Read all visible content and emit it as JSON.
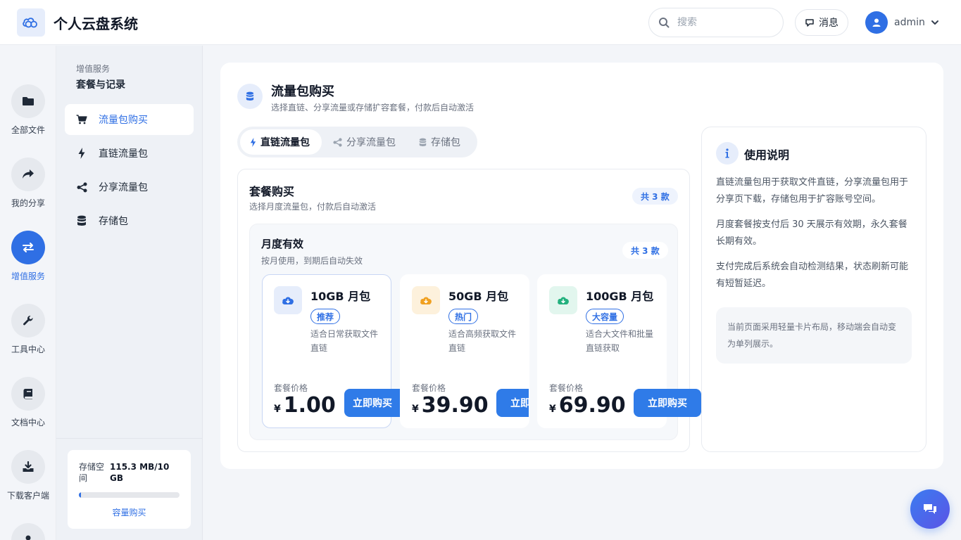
{
  "app": {
    "title": "个人云盘系统"
  },
  "header": {
    "search_placeholder": "搜索",
    "messages_label": "消息",
    "user_name": "admin"
  },
  "rail": {
    "items": [
      {
        "label": "全部文件",
        "icon": "folder-icon"
      },
      {
        "label": "我的分享",
        "icon": "share-arrow-icon"
      },
      {
        "label": "增值服务",
        "icon": "exchange-icon",
        "active": true
      },
      {
        "label": "工具中心",
        "icon": "wrench-icon"
      },
      {
        "label": "文档中心",
        "icon": "book-icon"
      },
      {
        "label": "下载客户端",
        "icon": "download-icon"
      }
    ]
  },
  "sidebar": {
    "category": "增值服务",
    "title": "套餐与记录",
    "items": [
      {
        "label": "流量包购买",
        "icon": "cart-icon",
        "active": true
      },
      {
        "label": "直链流量包",
        "icon": "bolt-icon"
      },
      {
        "label": "分享流量包",
        "icon": "share-nodes-icon"
      },
      {
        "label": "存储包",
        "icon": "database-icon"
      }
    ],
    "storage": {
      "label": "存储空间",
      "value": "115.3 MB/10 GB",
      "used_fraction": 0.011,
      "link": "容量购买"
    }
  },
  "main": {
    "title": "流量包购买",
    "subtitle": "选择直链、分享流量或存储扩容套餐，付款后自动激活",
    "tabs": [
      {
        "label": "直链流量包",
        "icon": "bolt-icon",
        "active": true
      },
      {
        "label": "分享流量包",
        "icon": "share-nodes-icon"
      },
      {
        "label": "存储包",
        "icon": "database-icon"
      }
    ],
    "packages": {
      "title": "套餐购买",
      "subtitle": "选择月度流量包，付款后自动激活",
      "count": "共 3 款",
      "group": {
        "title": "月度有效",
        "subtitle": "按月使用，到期后自动失效",
        "count": "共 3 款",
        "plans": [
          {
            "name": "10GB 月包",
            "tag": "推荐",
            "desc": "适合日常获取文件直链",
            "price_label": "套餐价格",
            "currency": "¥",
            "price": "1.00",
            "buy": "立即购买",
            "icon_color": "#2f6fe4",
            "icon_bg": "#e6edfb"
          },
          {
            "name": "50GB 月包",
            "tag": "热门",
            "desc": "适合高频获取文件直链",
            "price_label": "套餐价格",
            "currency": "¥",
            "price": "39.90",
            "buy": "立即购买",
            "icon_color": "#f0a020",
            "icon_bg": "#fdf1dc"
          },
          {
            "name": "100GB 月包",
            "tag": "大容量",
            "desc": "适合大文件和批量直链获取",
            "price_label": "套餐价格",
            "currency": "¥",
            "price": "69.90",
            "buy": "立即购买",
            "icon_color": "#22b07d",
            "icon_bg": "#e2f6ee"
          }
        ]
      }
    },
    "help": {
      "title": "使用说明",
      "paragraphs": [
        "直链流量包用于获取文件直链，分享流量包用于分享页下载，存储包用于扩容账号空间。",
        "月度套餐按支付后 30 天展示有效期，永久套餐长期有效。",
        "支付完成后系统会自动检测结果，状态刷新可能有短暂延迟。"
      ],
      "note": "当前页面采用轻量卡片布局，移动端会自动变为单列展示。"
    }
  },
  "colors": {
    "accent": "#2f6fe4",
    "button": "#2f7be8"
  }
}
